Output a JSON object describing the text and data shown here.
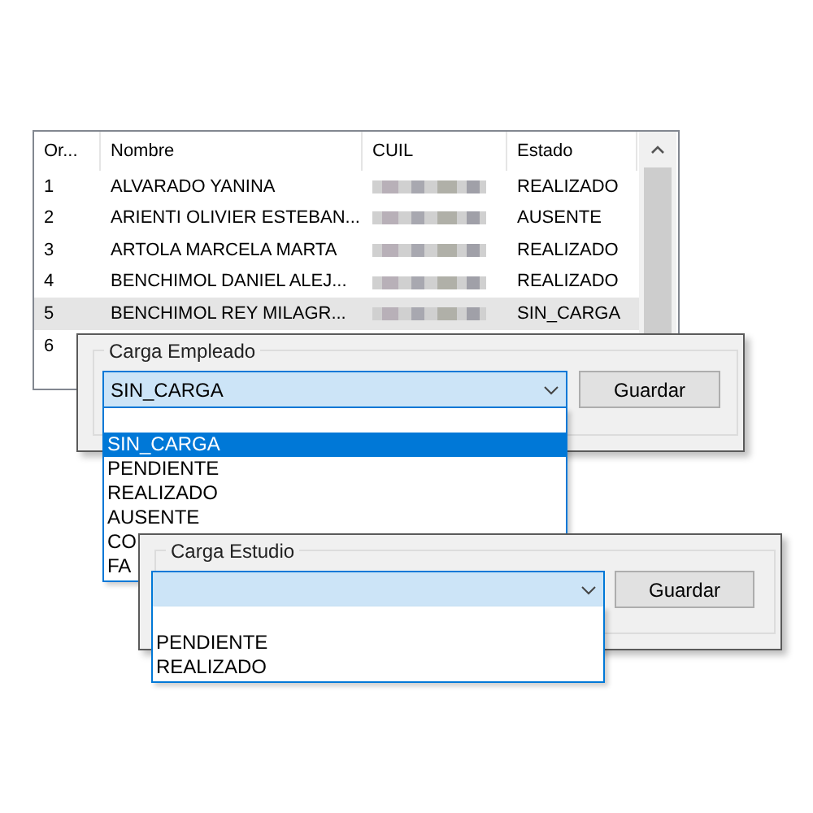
{
  "table": {
    "columns": [
      "Or...",
      "Nombre",
      "CUIL",
      "Estado"
    ],
    "rows": [
      {
        "order": "1",
        "name": "ALVARADO YANINA",
        "status": "REALIZADO",
        "selected": false
      },
      {
        "order": "2",
        "name": "ARIENTI OLIVIER ESTEBAN...",
        "status": "AUSENTE",
        "selected": false
      },
      {
        "order": "3",
        "name": "ARTOLA MARCELA MARTA",
        "status": "REALIZADO",
        "selected": false
      },
      {
        "order": "4",
        "name": "BENCHIMOL DANIEL ALEJ...",
        "status": "REALIZADO",
        "selected": false
      },
      {
        "order": "5",
        "name": "BENCHIMOL REY MILAGR...",
        "status": "SIN_CARGA",
        "selected": true
      },
      {
        "order": "6",
        "selected": false
      }
    ]
  },
  "panels": [
    {
      "title": "Carga Empleado",
      "value": "SIN_CARGA",
      "button": "Guardar",
      "options": [
        {
          "kind": "blank",
          "selected": false
        },
        {
          "kind": "text",
          "label": "SIN_CARGA",
          "selected": true
        },
        {
          "kind": "text",
          "label": "PENDIENTE",
          "selected": false
        },
        {
          "kind": "text",
          "label": "REALIZADO",
          "selected": false
        },
        {
          "kind": "text",
          "label": "AUSENTE",
          "selected": false
        },
        {
          "kind": "text",
          "label": "CO",
          "selected": false
        },
        {
          "kind": "text",
          "label": "FA",
          "selected": false
        }
      ]
    },
    {
      "title": "Carga Estudio",
      "button": "Guardar",
      "options": [
        {
          "kind": "blank",
          "selected": false
        },
        {
          "kind": "text",
          "label": "PENDIENTE",
          "selected": false
        },
        {
          "kind": "text",
          "label": "REALIZADO",
          "selected": false
        }
      ]
    }
  ]
}
